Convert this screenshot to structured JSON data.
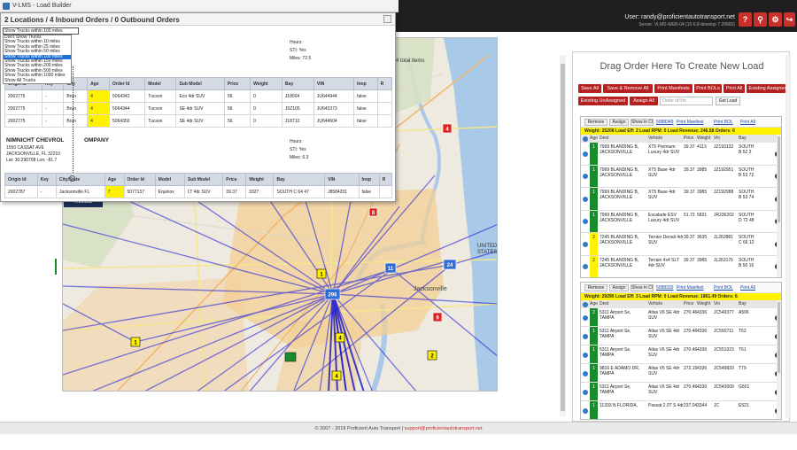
{
  "window": {
    "title": "V-LMS - Load Builder"
  },
  "header": {
    "user": "User: randy@proficientautotransport.net",
    "server": "Server: VLMS-WEB-04 (10.6.8-develop 7 26665)"
  },
  "popup": {
    "title": "2 Locations / 4 Inbound Orders / 0 Outbound Orders",
    "select_value": "Show Trucks within 100 miles",
    "truck_options": [
      "Don't Show Trucks",
      "Show Trucks within 10 miles",
      "Show Trucks within 25 miles",
      "Show Trucks within 50 miles",
      "Show Trucks within 100 miles",
      "Show Trucks within 150 miles",
      "Show Trucks within 200 miles",
      "Show Trucks within 500 miles",
      "Show Trucks within 1000 miles",
      "Show All Trucks"
    ],
    "selected_index": 4,
    "loc1": {
      "hours": "Hours:",
      "sti": "STI: Yes",
      "miles": "Miles: 72.5"
    },
    "loc2": {
      "name_a": "NIMNICHT CHEVROL",
      "name_b": "OMPANY",
      "addr1": "1550 CASSAT AVE",
      "addr2": "JACKSONVILLE, FL 32210",
      "latlon": "Lat: 30.290708 Lon: -81.7",
      "hours": "Hours:",
      "sti": "STI: Yes",
      "miles": "Miles: 6.3"
    },
    "columns1": [
      "Origin Id",
      "Key",
      "City",
      "Age",
      "Order Id",
      "Model",
      "Sub Model",
      "Price",
      "Weight",
      "Bay",
      "VIN",
      "Inop",
      "R"
    ],
    "rows1": [
      [
        "2002775",
        "-",
        "Brun",
        "4",
        "5064342",
        "Tucson",
        "Eco 4dr SUV",
        "56",
        "0",
        "J18504",
        "JU644944",
        "false",
        ""
      ],
      [
        "2002775",
        "-",
        "Brun",
        "4",
        "5064344",
        "Tucson",
        "SE 4dr SUV",
        "56",
        "0",
        "J9Z105",
        "JU643373",
        "false",
        ""
      ],
      [
        "2002775",
        "-",
        "Brun",
        "4",
        "5064350",
        "Tucson",
        "SE 4dr SUV",
        "56",
        "0",
        "J18713",
        "JU644604",
        "false",
        ""
      ]
    ],
    "columns2": [
      "Origin Id",
      "Key",
      "City/State",
      "Age",
      "Order Id",
      "Model",
      "Sub Model",
      "Price",
      "Weight",
      "Bay",
      "VIN",
      "Inop",
      "R"
    ],
    "rows2": [
      [
        "2002787",
        "-",
        "Jacksonville FL",
        "7",
        "5077137",
        "Equinox",
        "LT 4dr SUV",
        "39.37",
        "3327",
        "SOUTH C 64 47",
        "J8584201",
        "false",
        ""
      ]
    ]
  },
  "map": {
    "menu_label": "Menu",
    "total_items": "4 total items",
    "markers": [
      {
        "label": "4",
        "kind": "red"
      },
      {
        "label": "8",
        "kind": "red"
      },
      {
        "label": "9",
        "kind": "red"
      },
      {
        "label": "1",
        "kind": "yellow"
      },
      {
        "label": "1",
        "kind": "yellow"
      },
      {
        "label": "4",
        "kind": "yellow"
      },
      {
        "label": "2",
        "kind": "yellow"
      },
      {
        "label": "4",
        "kind": "yellow"
      },
      {
        "label": "11",
        "kind": "blue"
      },
      {
        "label": "24",
        "kind": "blue"
      },
      {
        "label": "296",
        "kind": "blue"
      }
    ]
  },
  "right": {
    "drag_title": "Drag Order Here To Create New Load",
    "buttons_row1": [
      "Save All",
      "Save & Remove All",
      "Print Manifests",
      "Print BOLs",
      "Print All",
      "Existing Assigned"
    ],
    "buttons_row2": [
      "Existing UnAssigned",
      "Assign All"
    ],
    "order_placeholder": "Order Id/Vin",
    "get_load": "Get Load",
    "load1": {
      "remove": "Remove",
      "assign": "Assign",
      "show": "Show in Cl",
      "load_id": "5088349",
      "print_manifest": "Print Manifest",
      "print_bol": "Print BOL",
      "print_all": "Print All",
      "summary": "Weight: 25208  Load Eff: 2  Load RPM: 0  Load Revenue: 246.58  Orders: 6",
      "headers": [
        "Age",
        "Dest",
        "Vehicle",
        "Price",
        "Weight",
        "Vin",
        "Bay"
      ],
      "rows": [
        {
          "age": "1",
          "c": "g",
          "dest": "7999 BLANDING B, JACKSONVILLE",
          "veh": "XT5 Premium Luxury 4dr SUV",
          "price": "39.37",
          "weight": "4113",
          "vin": "JZ193132",
          "bay": "SOUTH B 52 3"
        },
        {
          "age": "1",
          "c": "g",
          "dest": "7999 BLANDING B, JACKSONVILLE",
          "veh": "XT5 Base 4dr SUV",
          "price": "39.37",
          "weight": "3985",
          "vin": "JZ192951",
          "bay": "SOUTH B 53 72"
        },
        {
          "age": "1",
          "c": "g",
          "dest": "7999 BLANDING B, JACKSONVILLE",
          "veh": "XT5 Base 4dr SUV",
          "price": "39.37",
          "weight": "3985",
          "vin": "JZ192988",
          "bay": "SOUTH B 53 74"
        },
        {
          "age": "1",
          "c": "g",
          "dest": "7999 BLANDING B, JACKSONVILLE",
          "veh": "Escalade ESV Luxury 4dr SUV",
          "price": "51.73",
          "weight": "5831",
          "vin": "JR236202",
          "bay": "SOUTH D 72 48"
        },
        {
          "age": "2",
          "c": "y",
          "dest": "7245 BLANDING B, JACKSONVILLE",
          "veh": "Terrain Denali 4dr SUV",
          "price": "39.37",
          "weight": "3635",
          "vin": "JL262881",
          "bay": "SOUTH C 66 12"
        },
        {
          "age": "2",
          "c": "y",
          "dest": "7245 BLANDING B, JACKSONVILLE",
          "veh": "Terrain 4x4 SLT 4dr SUV",
          "price": "39.37",
          "weight": "3985",
          "vin": "JL263176",
          "bay": "SOUTH B 50 16"
        }
      ]
    },
    "load2": {
      "remove": "Remove",
      "assign": "Assign",
      "show": "Show in Cl",
      "load_id": "5088332",
      "print_manifest": "Print Manifest",
      "print_bol": "Print BOL",
      "print_all": "Print All",
      "summary": "Weight: 29290  Load Eff: 3  Load RPM: 0  Load Revenue: 1861.49  Orders: 6",
      "headers": [
        "Age",
        "Dest",
        "Vehicle",
        "Price",
        "Weight",
        "Vin",
        "Bay"
      ],
      "rows": [
        {
          "age": "2",
          "c": "g",
          "dest": "5311 Airport Se, TAMPA",
          "veh": "Atlas V6 SE 4dr SUV",
          "price": "270.46",
          "weight": "4336",
          "vin": "JC549377",
          "bay": "A506"
        },
        {
          "age": "1",
          "c": "g",
          "dest": "5311 Airport Se, TAMPA",
          "veh": "Atlas V6 SE 4dr SUV",
          "price": "270.46",
          "weight": "4336",
          "vin": "JC550711",
          "bay": "T52"
        },
        {
          "age": "1",
          "c": "g",
          "dest": "5311 Airport Se, TAMPA",
          "veh": "Atlas V6 SE 4dr SUV",
          "price": "270.46",
          "weight": "4336",
          "vin": "JC551023",
          "bay": "T61"
        },
        {
          "age": "1",
          "c": "g",
          "dest": "9816 E ADAMO DR, TAMPA",
          "veh": "Atlas V6 SE 4dr SUV",
          "price": "272.15",
          "weight": "4336",
          "vin": "JC549833",
          "bay": "T79"
        },
        {
          "age": "1",
          "c": "g",
          "dest": "5311 Airport Se, TAMPA",
          "veh": "Atlas V6 SE 4dr SUV",
          "price": "270.46",
          "weight": "4336",
          "vin": "JC543009",
          "bay": "G501"
        },
        {
          "age": "1",
          "c": "g",
          "dest": "11333 N FLORIDA,",
          "veh": "Passat 2.0T S 4dr",
          "price": "237.04",
          "weight": "3344",
          "vin": "JC",
          "bay": "E521"
        }
      ]
    }
  },
  "footer": {
    "copy": "© 2007 - 2018 Proficient Auto Transport | ",
    "support": "support@proficientautotransport.net"
  },
  "colors": {
    "accent_red": "#c9302c",
    "summary_yellow": "#fff200",
    "age_green": "#1a8a2a",
    "route_blue": "#2222dd"
  }
}
